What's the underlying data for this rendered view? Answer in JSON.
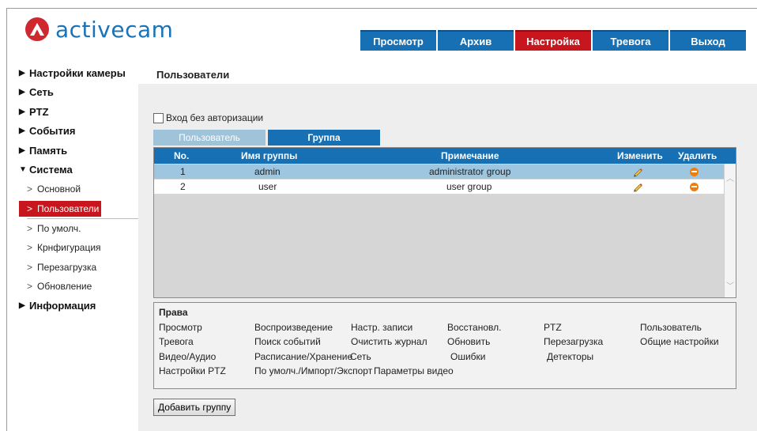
{
  "brand": {
    "name": "activecam",
    "logo_color": "#d0282f",
    "text_color": "#1a73b6"
  },
  "nav": {
    "tabs": [
      {
        "label": "Просмотр",
        "active": false
      },
      {
        "label": "Архив",
        "active": false
      },
      {
        "label": "Настройка",
        "active": true
      },
      {
        "label": "Тревога",
        "active": false
      },
      {
        "label": "Выход",
        "active": false
      }
    ],
    "accent": "#1670b3",
    "active_color": "#c7161d"
  },
  "sidebar": {
    "top": [
      {
        "label": "Настройки камеры",
        "icon": "triangle-right-icon"
      },
      {
        "label": "Сеть",
        "icon": "triangle-right-icon"
      },
      {
        "label": "PTZ",
        "icon": "triangle-right-icon"
      },
      {
        "label": "События",
        "icon": "triangle-right-icon"
      },
      {
        "label": "Память",
        "icon": "triangle-right-icon"
      },
      {
        "label": "Система",
        "icon": "triangle-down-icon"
      }
    ],
    "system_items": [
      {
        "label": "Основной",
        "active": false
      },
      {
        "label": "Пользователи",
        "active": true
      },
      {
        "label": "По умолч.",
        "active": false
      },
      {
        "label": "Крнфигурация",
        "active": false
      },
      {
        "label": "Перезагрузка",
        "active": false
      },
      {
        "label": "Обновление",
        "active": false
      }
    ],
    "info": {
      "label": "Информация",
      "icon": "triangle-right-icon"
    }
  },
  "page": {
    "title": "Пользователи",
    "no_auth_label": "Вход без авторизации",
    "no_auth_checked": false,
    "subtabs": [
      {
        "label": "Пользователь",
        "active": false
      },
      {
        "label": "Группа",
        "active": true
      }
    ]
  },
  "grid": {
    "headers": {
      "no": "No.",
      "name": "Имя группы",
      "note": "Примечание",
      "edit": "Изменить",
      "delete": "Удалить"
    },
    "rows": [
      {
        "no": "1",
        "name": "admin",
        "note": "administrator group",
        "selected": true
      },
      {
        "no": "2",
        "name": "user",
        "note": "user group",
        "selected": false
      }
    ]
  },
  "rights": {
    "title": "Права",
    "rows": [
      [
        "Просмотр",
        "Воспроизведение",
        "Настр. записи",
        "Восстановл.",
        "PTZ",
        "Пользователь"
      ],
      [
        "Тревога",
        "Поиск событий",
        "Очистить журнал",
        "Обновить",
        "Перезагрузка",
        "Общие настройки"
      ],
      [
        "Видео/Аудио",
        "Расписание/Хранение",
        "Сеть",
        "Ошибки",
        "Детекторы"
      ],
      [
        "Настройки PTZ",
        "По умолч./Импорт/Экспорт",
        "Параметры видео"
      ]
    ]
  },
  "add_group_button": "Добавить группу"
}
